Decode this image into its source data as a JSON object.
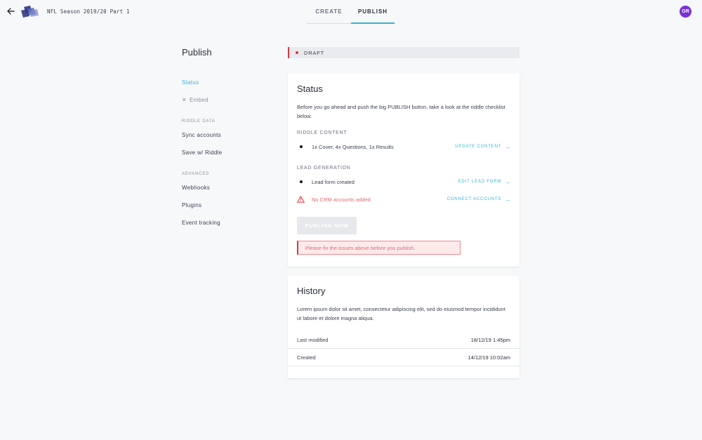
{
  "header": {
    "document_title": "NFL Season 2019/20 Part 1",
    "tabs": [
      {
        "label": "CREATE",
        "active": false
      },
      {
        "label": "PUBLISH",
        "active": true
      }
    ],
    "avatar_initials": "GR",
    "avatar_color": "#7b2fd8"
  },
  "sidebar": {
    "title": "Publish",
    "items_main": [
      {
        "label": "Status",
        "active": true
      },
      {
        "label": "Embed",
        "disabled": true
      }
    ],
    "section_riddle_data": "RIDDLE DATA",
    "items_riddle_data": [
      "Sync accounts",
      "Save w/ Riddle"
    ],
    "section_advanced": "ADVANCED",
    "items_advanced": [
      "Webhooks",
      "Plugins",
      "Event tracking"
    ]
  },
  "draft_status": {
    "label": "DRAFT",
    "color": "#e0323b"
  },
  "status_card": {
    "title": "Status",
    "description": "Before you go ahead and push the big PUBLISH button, take a look at the riddle checklist below.",
    "riddle_content": {
      "label": "RIDDLE CONTENT",
      "item": "1x Cover, 4x Questions, 1x Results",
      "action": "UPDATE CONTENT"
    },
    "lead_generation": {
      "label": "LEAD GENERATION",
      "item_ok": "Lead form created",
      "item_ok_action": "EDIT LEAD FORM",
      "item_error": "No CRM accounts added",
      "item_error_action": "CONNECT ACCOUNTS"
    },
    "publish_button": "PUBLISH NOW",
    "error_message": "Please fix the issues above before you publish."
  },
  "history_card": {
    "title": "History",
    "description": "Lorem ipsum dolor sit amet, consectetur adipiscing elit, sed do eiusmod tempor incididunt ut labore et dolore magna aliqua.",
    "rows": [
      {
        "label": "Last modified",
        "value": "18/12/19 1:45pm"
      },
      {
        "label": "Created",
        "value": "14/12/19 10:02am"
      }
    ]
  },
  "colors": {
    "accent": "#35b5d6",
    "error": "#e0323b",
    "error_text": "#e56b6f"
  }
}
